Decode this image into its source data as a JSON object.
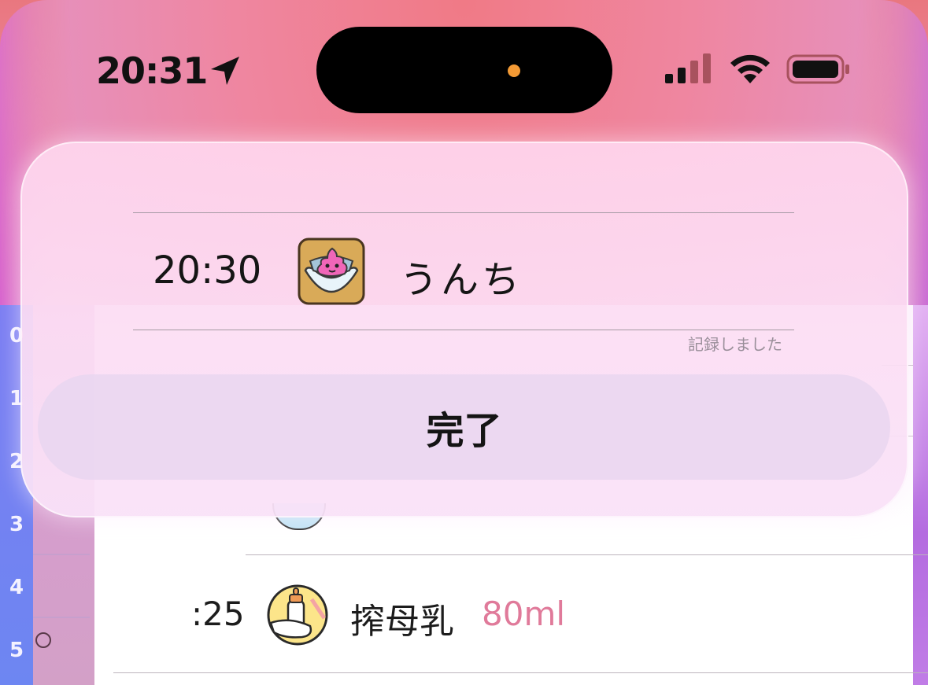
{
  "status_bar": {
    "time": "20:31",
    "location_icon": "location-arrow-icon",
    "signal_icon": "cellular-signal-icon",
    "wifi_icon": "wifi-icon",
    "battery_icon": "battery-icon"
  },
  "background_list": {
    "hours": [
      "0",
      "1",
      "2",
      "3",
      "4",
      "5"
    ],
    "entry": {
      "time": ":25",
      "label": "搾母乳",
      "amount": "80ml",
      "icon": "baby-bottle-icon"
    }
  },
  "popup": {
    "time": "20:30",
    "icon": "poop-diaper-icon",
    "label": "うんち",
    "note": "記録しました",
    "done_label": "完了"
  },
  "colors": {
    "accent_amount": "#e07a9a",
    "rail_blue": "#6d86f2",
    "dynamic_island_dot": "#f39a35"
  }
}
